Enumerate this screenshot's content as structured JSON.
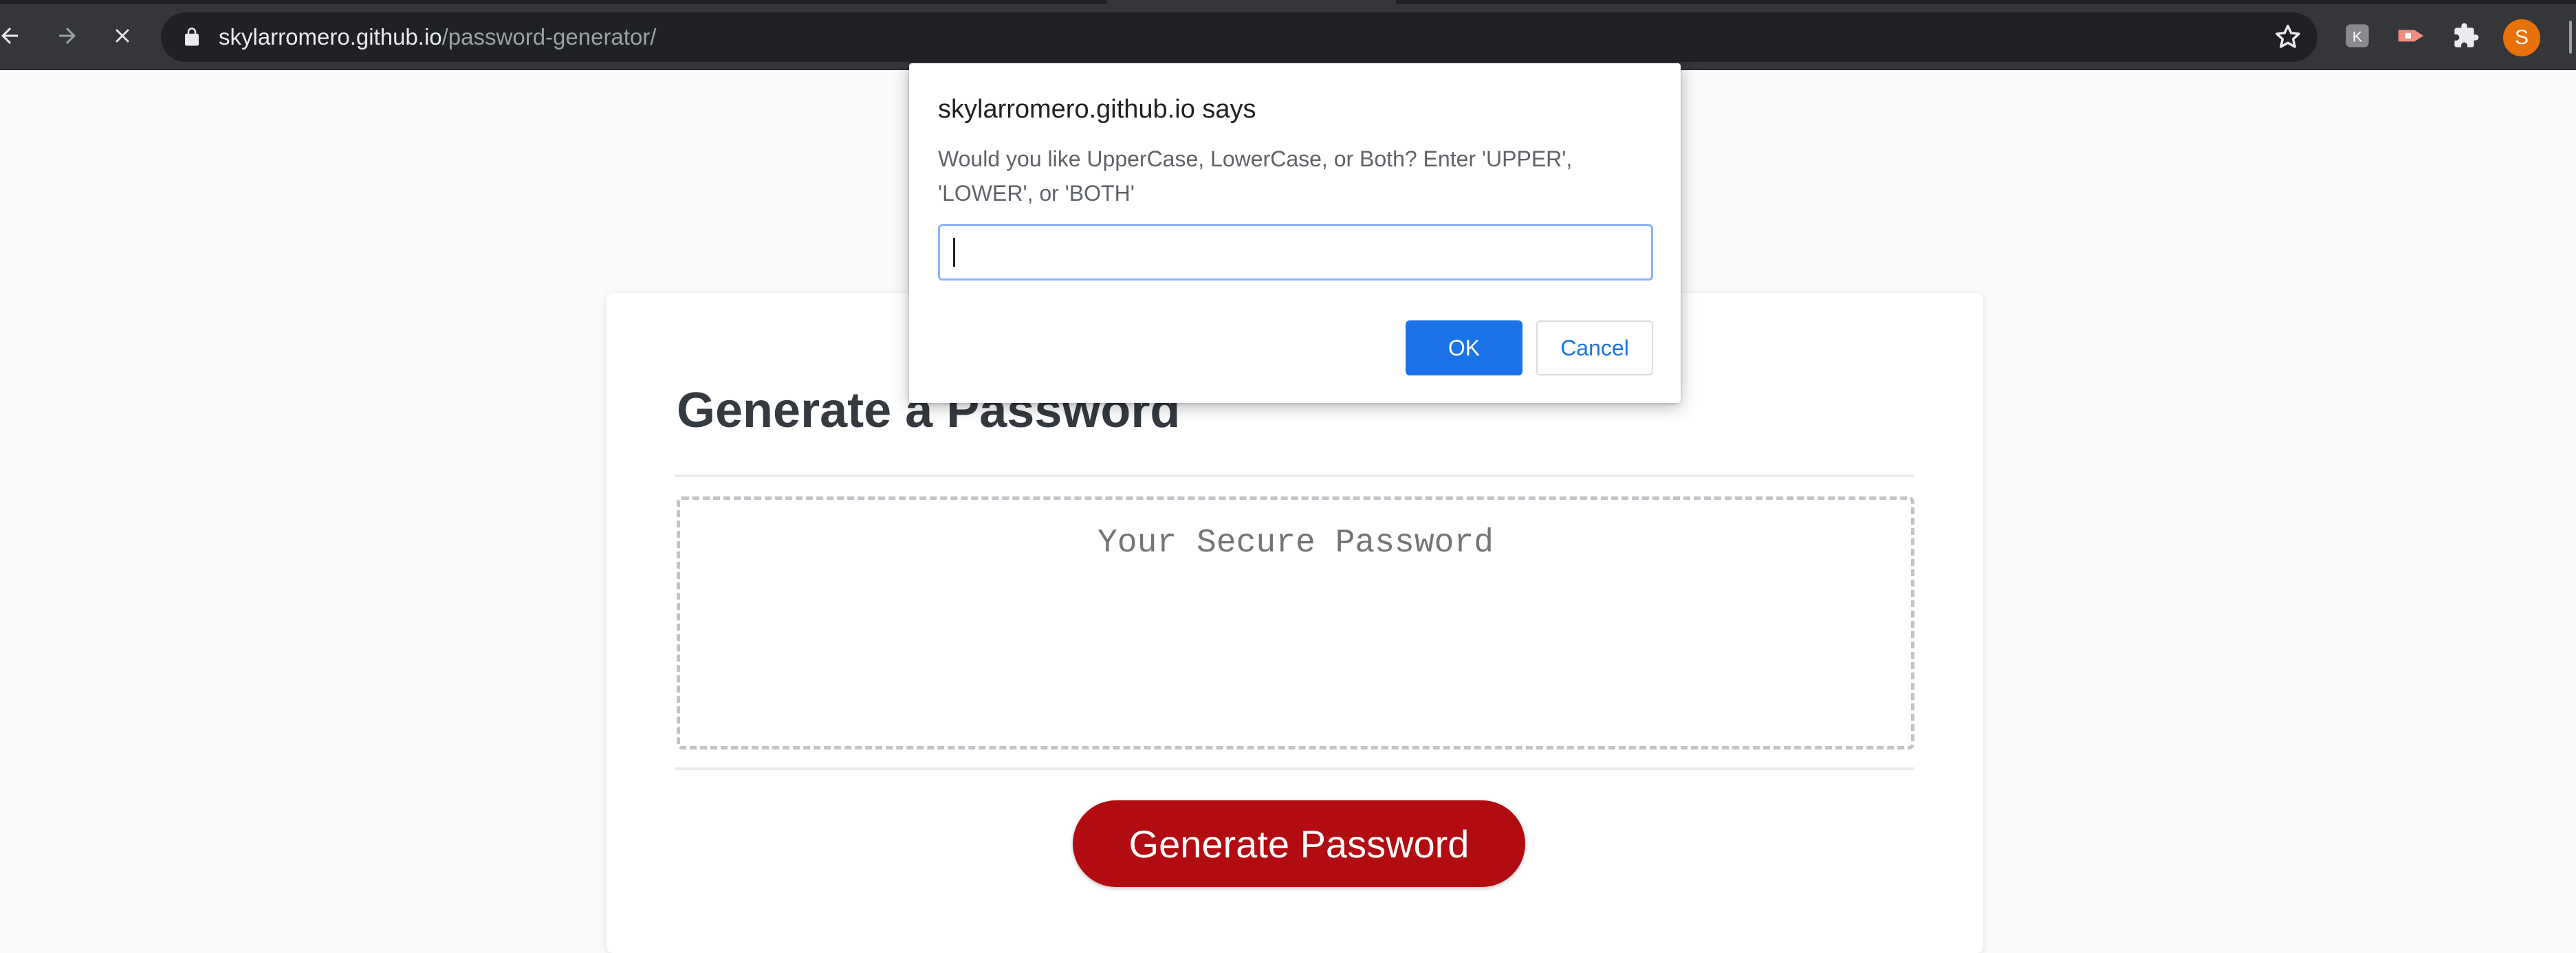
{
  "browser": {
    "url_host": "skylarromero.github.io",
    "url_path": "/password-generator/",
    "profile_initial": "S",
    "toolbar_icons": [
      "back-icon",
      "forward-icon",
      "stop-loading-icon",
      "lock-icon",
      "bookmark-star-icon",
      "extension-icon",
      "extension-icon",
      "puzzle-extensions-icon",
      "profile-avatar"
    ]
  },
  "page": {
    "title": "Generate a Password",
    "password_placeholder": "Your Secure Password",
    "generate_button": "Generate Password",
    "colors": {
      "button": "#b20b11",
      "title": "#343a40"
    }
  },
  "dialog": {
    "title": "skylarromero.github.io says",
    "message": "Would you like UpperCase, LowerCase, or Both? Enter 'UPPER', 'LOWER', or 'BOTH'",
    "input_value": "",
    "ok_label": "OK",
    "cancel_label": "Cancel",
    "colors": {
      "ok": "#1a73e8"
    }
  }
}
